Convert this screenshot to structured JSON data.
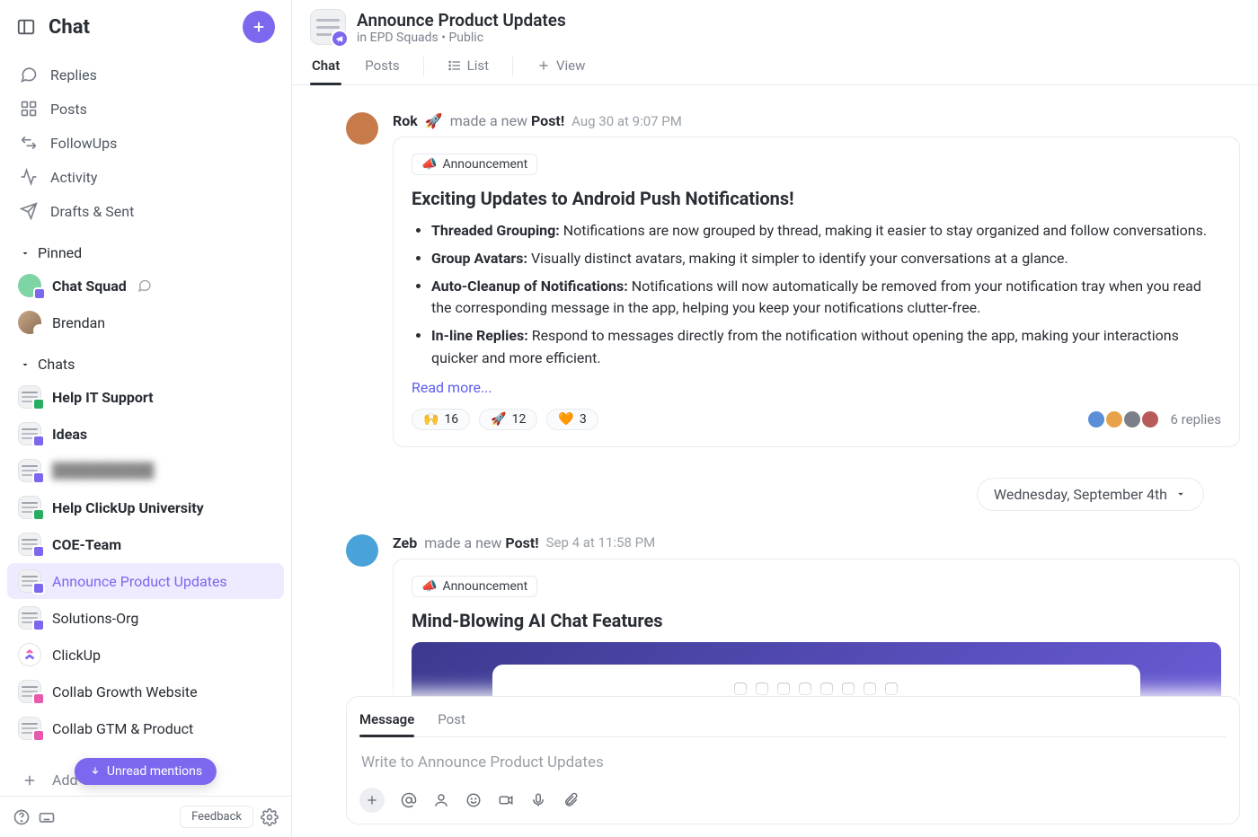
{
  "sidebar": {
    "title": "Chat",
    "nav": [
      {
        "label": "Replies",
        "icon": "replies"
      },
      {
        "label": "Posts",
        "icon": "posts"
      },
      {
        "label": "FollowUps",
        "icon": "followups"
      },
      {
        "label": "Activity",
        "icon": "activity"
      },
      {
        "label": "Drafts & Sent",
        "icon": "drafts"
      }
    ],
    "pinned_label": "Pinned",
    "pinned": [
      {
        "label": "Chat Squad",
        "bold": true,
        "avatar": "green-person",
        "trailing_icon": "chat-bubble"
      },
      {
        "label": "Brendan",
        "bold": false,
        "avatar": "person"
      }
    ],
    "chats_label": "Chats",
    "chats": [
      {
        "label": "Help IT Support",
        "avatar": "green-list",
        "bold": true
      },
      {
        "label": "Ideas",
        "avatar": "list",
        "bold": true
      },
      {
        "label": "██████████",
        "avatar": "list",
        "bold": false,
        "blurred": true
      },
      {
        "label": "Help ClickUp University",
        "avatar": "green-list",
        "bold": true
      },
      {
        "label": "COE-Team",
        "avatar": "list",
        "bold": true
      },
      {
        "label": "Announce Product Updates",
        "avatar": "list",
        "bold": false,
        "active": true
      },
      {
        "label": "Solutions-Org",
        "avatar": "list",
        "bold": false
      },
      {
        "label": "ClickUp",
        "avatar": "clickup",
        "bold": false
      },
      {
        "label": "Collab Growth Website",
        "avatar": "list-pink",
        "bold": false
      },
      {
        "label": "Collab GTM & Product",
        "avatar": "list-pink",
        "bold": false
      }
    ],
    "add_label": "Add Chat",
    "unread_pill": "Unread mentions",
    "feedback": "Feedback"
  },
  "header": {
    "title": "Announce Product Updates",
    "sub_prefix": "in ",
    "sub_space": "EPD Squads",
    "sub_sep": " • ",
    "sub_visibility": "Public"
  },
  "tabs": {
    "chat": "Chat",
    "posts": "Posts",
    "list": "List",
    "view": "View"
  },
  "posts": [
    {
      "author": "Rok",
      "author_emoji": "🚀",
      "meta_prefix": "made a new ",
      "meta_strong": "Post!",
      "timestamp": "Aug 30 at 9:07 PM",
      "announcement_label": "Announcement",
      "title": "Exciting Updates to Android Push Notifications!",
      "bullets": [
        {
          "bold": "Threaded Grouping:",
          "text": " Notifications are now grouped by thread, making it easier to stay organized and follow conversations."
        },
        {
          "bold": "Group Avatars:",
          "text": " Visually distinct avatars, making it simpler to identify your conversations at a glance."
        },
        {
          "bold": "Auto-Cleanup of Notifications:",
          "text": " Notifications will now automatically be removed from your notification tray when you read the corresponding message in the app, helping you keep your notifications clutter-free."
        },
        {
          "bold": "In-line Replies:",
          "text": " Respond to messages directly from the notification without opening the app, making your interactions quicker and more efficient."
        }
      ],
      "read_more": "Read more...",
      "reactions": [
        {
          "emoji": "🙌",
          "count": "16"
        },
        {
          "emoji": "🚀",
          "count": "12"
        },
        {
          "emoji": "🧡",
          "count": "3"
        }
      ],
      "reply_avatars": 4,
      "replies_text": "6 replies",
      "avatar_color": "#c77b4a"
    },
    {
      "author": "Zeb",
      "author_emoji": "",
      "meta_prefix": "made a new ",
      "meta_strong": "Post!",
      "timestamp": "Sep 4 at 11:58 PM",
      "announcement_label": "Announcement",
      "title": "Mind-Blowing AI Chat Features",
      "has_media": true,
      "avatar_color": "#4aa3d8"
    }
  ],
  "date_separator": "Wednesday, September 4th",
  "composer": {
    "tab_message": "Message",
    "tab_post": "Post",
    "placeholder": "Write to Announce Product Updates"
  }
}
